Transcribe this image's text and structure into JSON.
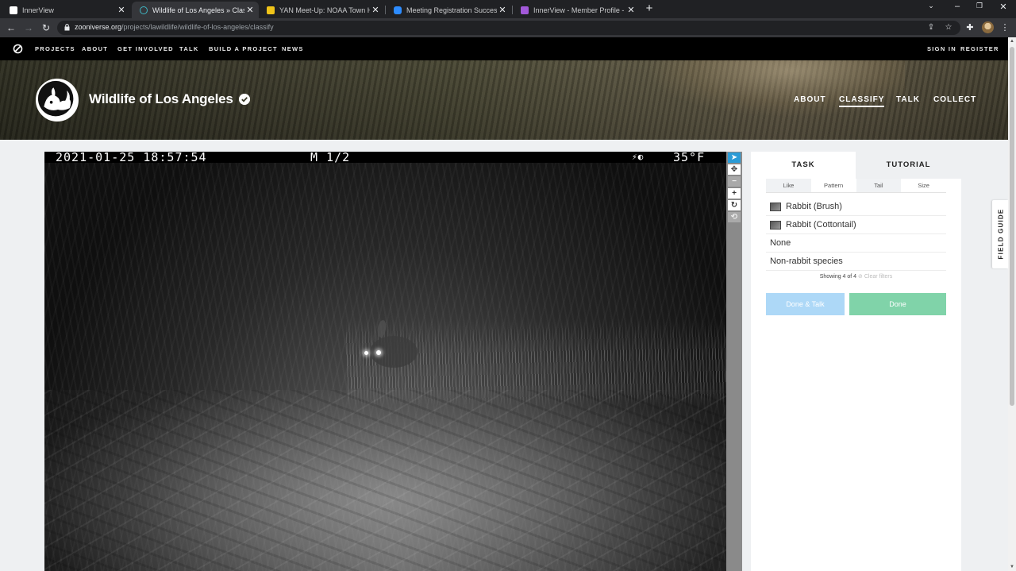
{
  "browser": {
    "tabs": [
      {
        "title": "InnerView",
        "favicon_color": "#ffffff"
      },
      {
        "title": "Wildlife of Los Angeles » Classify",
        "favicon_color": "#3fb6c4"
      },
      {
        "title": "YAN Meet-Up: NOAA Town Hall",
        "favicon_color": "#f0c419"
      },
      {
        "title": "Meeting Registration Success - Z",
        "favicon_color": "#2d8cff"
      },
      {
        "title": "InnerView - Member Profile - Ca",
        "favicon_color": "#a259d9"
      }
    ],
    "new_tab_label": "+",
    "url_host": "zooniverse.org",
    "url_path": "/projects/lawildlife/wildlife-of-los-angeles/classify"
  },
  "zooniverse_nav": {
    "items": [
      "PROJECTS",
      "ABOUT",
      "GET INVOLVED",
      "TALK",
      "BUILD A PROJECT",
      "NEWS"
    ],
    "sign_in": "SIGN IN",
    "register": "REGISTER"
  },
  "project": {
    "title": "Wildlife of Los Angeles",
    "nav": [
      "ABOUT",
      "CLASSIFY",
      "TALK",
      "COLLECT"
    ],
    "active_nav": "CLASSIFY"
  },
  "subject": {
    "timestamp": "2021-01-25 18:57:54",
    "frame": "M 1/2",
    "temperature": "35°F"
  },
  "task_panel": {
    "tabs": [
      "TASK",
      "TUTORIAL"
    ],
    "filters": [
      "Like",
      "Pattern",
      "Tail",
      "Size"
    ],
    "choices": [
      {
        "label": "Rabbit (Brush)",
        "thumb": true
      },
      {
        "label": "Rabbit (Cottontail)",
        "thumb": true
      },
      {
        "label": "None",
        "thumb": false
      },
      {
        "label": "Non-rabbit species",
        "thumb": false
      }
    ],
    "showing": "Showing 4 of 4",
    "clear_filters": "Clear filters",
    "done_talk": "Done & Talk",
    "done": "Done"
  },
  "field_guide": "FIELD GUIDE",
  "colors": {
    "talk_button": "#add8f7",
    "done_button": "#80d3a9",
    "active_tool": "#2a9bd6"
  }
}
